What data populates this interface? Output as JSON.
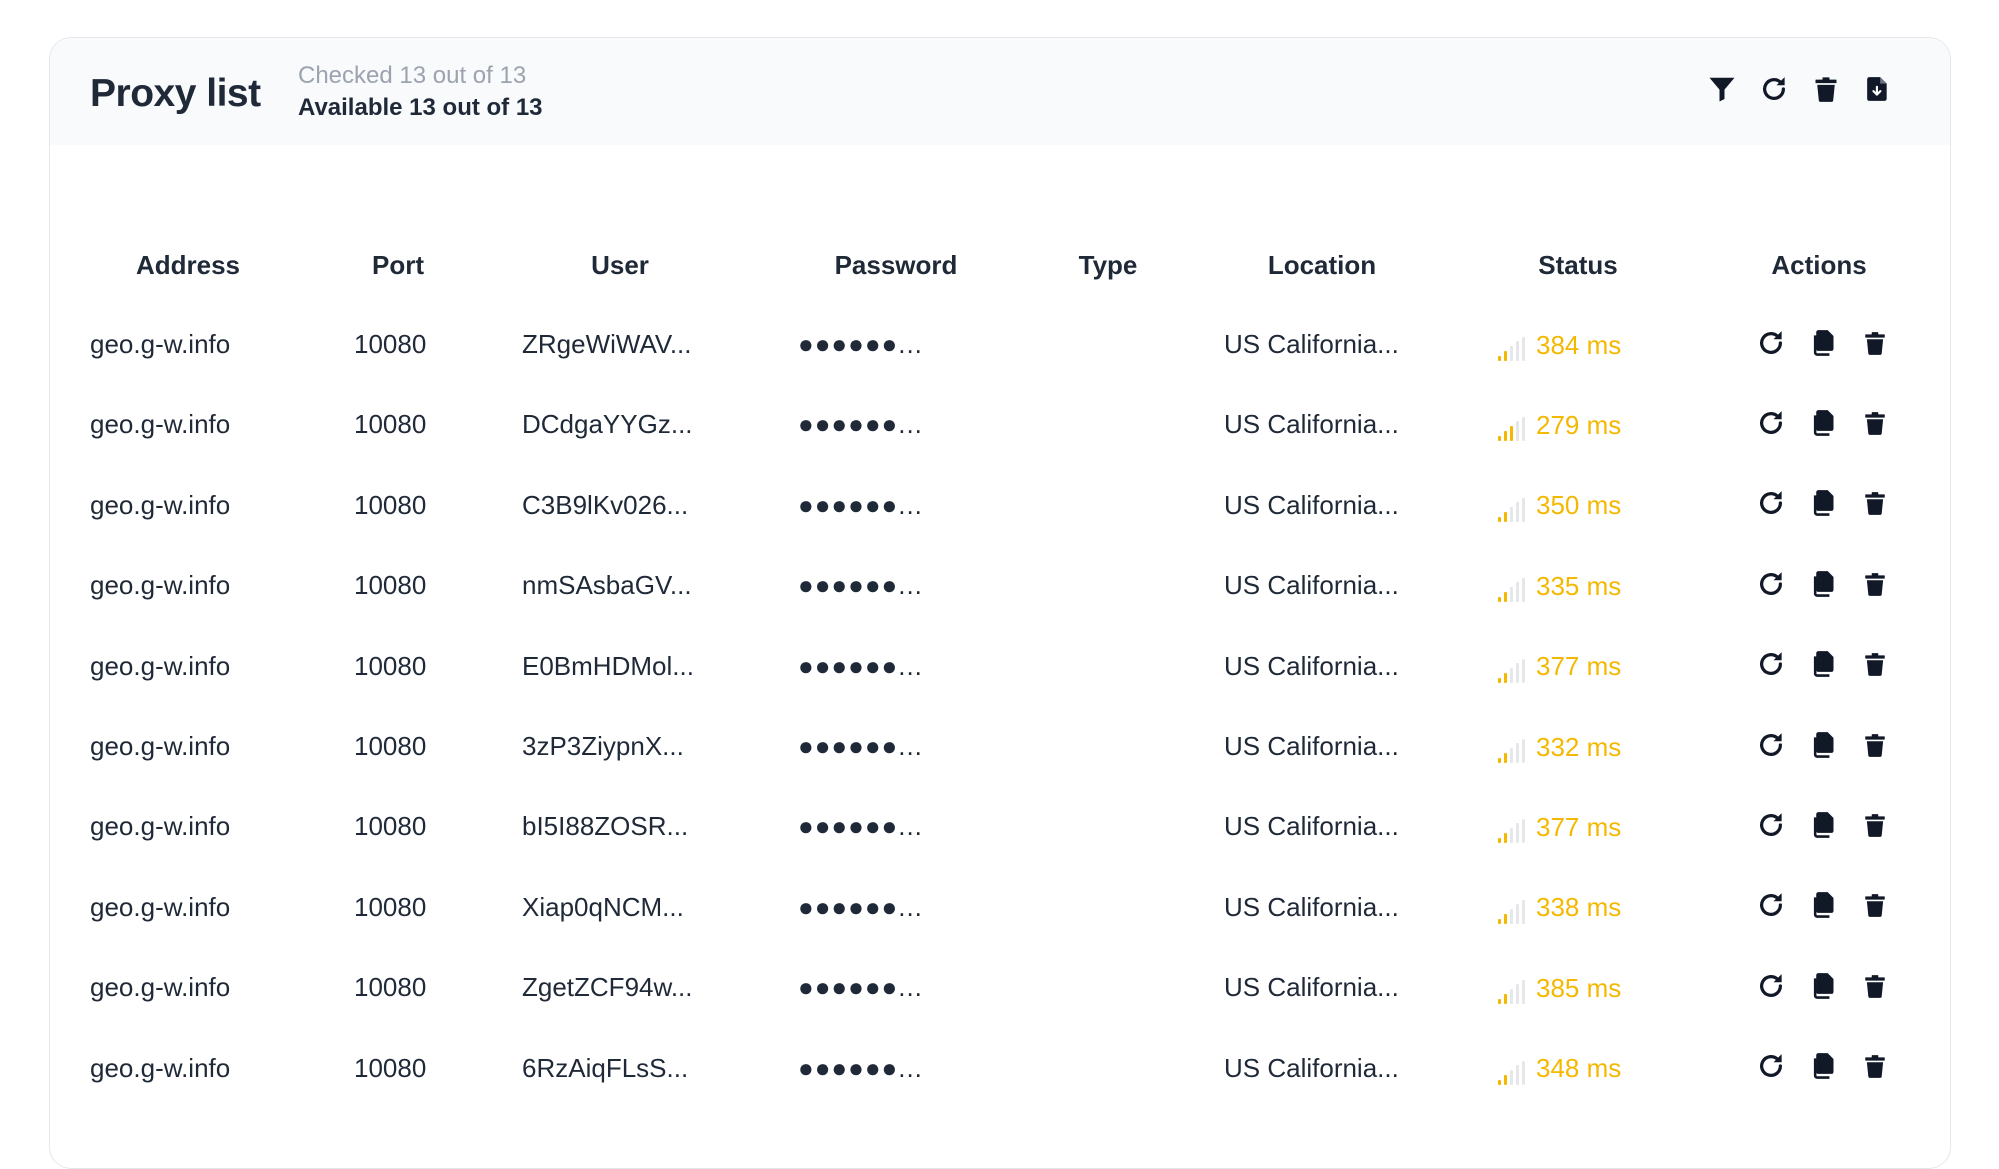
{
  "header": {
    "title": "Proxy list",
    "checked_text": "Checked 13 out of 13",
    "available_text": "Available 13 out of 13",
    "tools": [
      {
        "icon": "filter-icon"
      },
      {
        "icon": "refresh-icon"
      },
      {
        "icon": "trash-icon"
      },
      {
        "icon": "export-file-icon"
      }
    ]
  },
  "table": {
    "columns": [
      "Address",
      "Port",
      "User",
      "Password",
      "Type",
      "Location",
      "Status",
      "Actions"
    ],
    "rows": [
      {
        "address": "geo.g-w.info",
        "port": "10080",
        "user": "ZRgeWiWAV...",
        "password": "●●●●●●...",
        "type": "",
        "location": "US California...",
        "status": "384 ms",
        "signal_bars": 2
      },
      {
        "address": "geo.g-w.info",
        "port": "10080",
        "user": "DCdgaYYGz...",
        "password": "●●●●●●...",
        "type": "",
        "location": "US California...",
        "status": "279 ms",
        "signal_bars": 3
      },
      {
        "address": "geo.g-w.info",
        "port": "10080",
        "user": "C3B9lKv026...",
        "password": "●●●●●●...",
        "type": "",
        "location": "US California...",
        "status": "350 ms",
        "signal_bars": 2
      },
      {
        "address": "geo.g-w.info",
        "port": "10080",
        "user": "nmSAsbaGV...",
        "password": "●●●●●●...",
        "type": "",
        "location": "US California...",
        "status": "335 ms",
        "signal_bars": 2
      },
      {
        "address": "geo.g-w.info",
        "port": "10080",
        "user": "E0BmHDMol...",
        "password": "●●●●●●...",
        "type": "",
        "location": "US California...",
        "status": "377 ms",
        "signal_bars": 2
      },
      {
        "address": "geo.g-w.info",
        "port": "10080",
        "user": "3zP3ZiypnX...",
        "password": "●●●●●●...",
        "type": "",
        "location": "US California...",
        "status": "332 ms",
        "signal_bars": 2
      },
      {
        "address": "geo.g-w.info",
        "port": "10080",
        "user": "bI5I88ZOSR...",
        "password": "●●●●●●...",
        "type": "",
        "location": "US California...",
        "status": "377 ms",
        "signal_bars": 2
      },
      {
        "address": "geo.g-w.info",
        "port": "10080",
        "user": "Xiap0qNCM...",
        "password": "●●●●●●...",
        "type": "",
        "location": "US California...",
        "status": "338 ms",
        "signal_bars": 2
      },
      {
        "address": "geo.g-w.info",
        "port": "10080",
        "user": "ZgetZCF94w...",
        "password": "●●●●●●...",
        "type": "",
        "location": "US California...",
        "status": "385 ms",
        "signal_bars": 2
      },
      {
        "address": "geo.g-w.info",
        "port": "10080",
        "user": "6RzAiqFLsS...",
        "password": "●●●●●●...",
        "type": "",
        "location": "US California...",
        "status": "348 ms",
        "signal_bars": 2
      }
    ],
    "row_actions": [
      {
        "icon": "refresh-icon"
      },
      {
        "icon": "copy-icon"
      },
      {
        "icon": "trash-icon"
      }
    ]
  },
  "colors": {
    "status_warn": "#f5b800",
    "text": "#1f2937",
    "muted": "#9ca3af",
    "header_bg": "#f8fafc"
  }
}
